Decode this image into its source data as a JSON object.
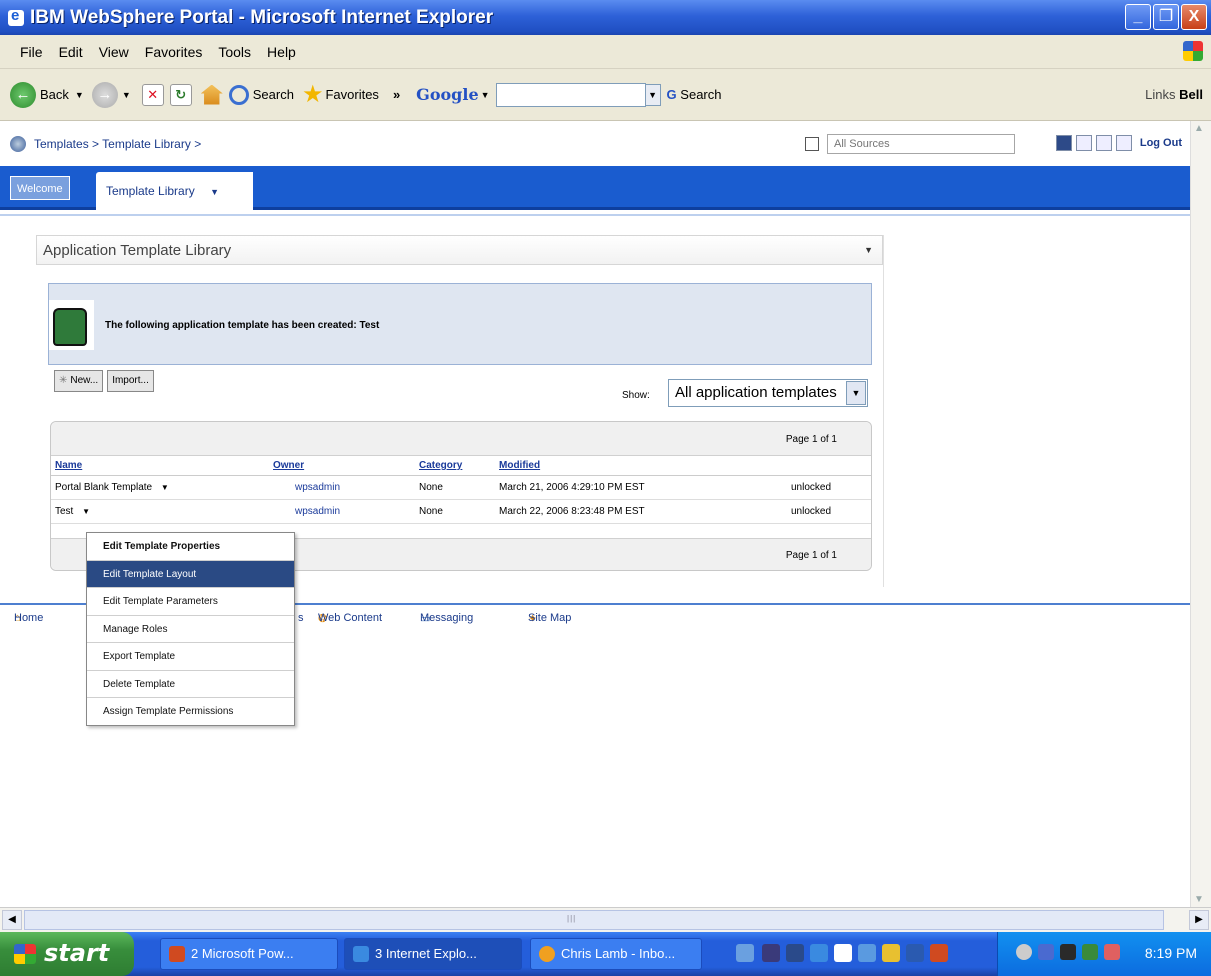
{
  "window": {
    "title": "IBM WebSphere Portal - Microsoft Internet Explorer",
    "buttons": [
      "_",
      "❐",
      "X"
    ]
  },
  "menubar": {
    "items": [
      "File",
      "Edit",
      "View",
      "Favorites",
      "Tools",
      "Help"
    ]
  },
  "toolbar": {
    "back": "Back",
    "search": "Search",
    "favorites": "Favorites",
    "chevron": "»",
    "google": "Google",
    "google_search": "Search",
    "links": "Links",
    "bell": "Bell"
  },
  "portal": {
    "breadcrumb": "Templates > Template Library >",
    "search_placeholder": "All Sources",
    "logout": "Log Out",
    "tabs": {
      "welcome": "Welcome",
      "active": "Template Library"
    }
  },
  "portlet": {
    "title": "Application Template Library",
    "message": "The following application template has been created: Test",
    "new_button": "New...",
    "import_button": "Import...",
    "show_label": "Show:",
    "show_value": "All application templates",
    "page_info_top": "Page 1 of 1",
    "page_info_bottom": "Page 1 of 1",
    "columns": [
      "Name",
      "Owner",
      "Category",
      "Modified"
    ],
    "rows": [
      {
        "name": "Portal Blank Template",
        "owner": "wpsadmin",
        "category": "None",
        "modified": "March 21, 2006 4:29:10 PM EST",
        "status": "unlocked"
      },
      {
        "name": "Test",
        "owner": "wpsadmin",
        "category": "None",
        "modified": "March 22, 2006 8:23:48 PM EST",
        "status": "unlocked"
      }
    ]
  },
  "context_menu": {
    "items": [
      "Edit Template Properties",
      "Edit Template Layout",
      "Edit Template Parameters",
      "Manage Roles",
      "Export Template",
      "Delete Template",
      "Assign Template Permissions"
    ],
    "selected": "Edit Template Layout"
  },
  "footer_nav": {
    "home": "Home",
    "s_fragment": "s",
    "web_content": "Web Content",
    "messaging": "Messaging",
    "site_map": "Site Map"
  },
  "taskbar": {
    "start": "start",
    "tasks": [
      "2 Microsoft Pow...",
      "3 Internet Explo...",
      "Chris Lamb - Inbo..."
    ],
    "clock": "8:19 PM"
  }
}
